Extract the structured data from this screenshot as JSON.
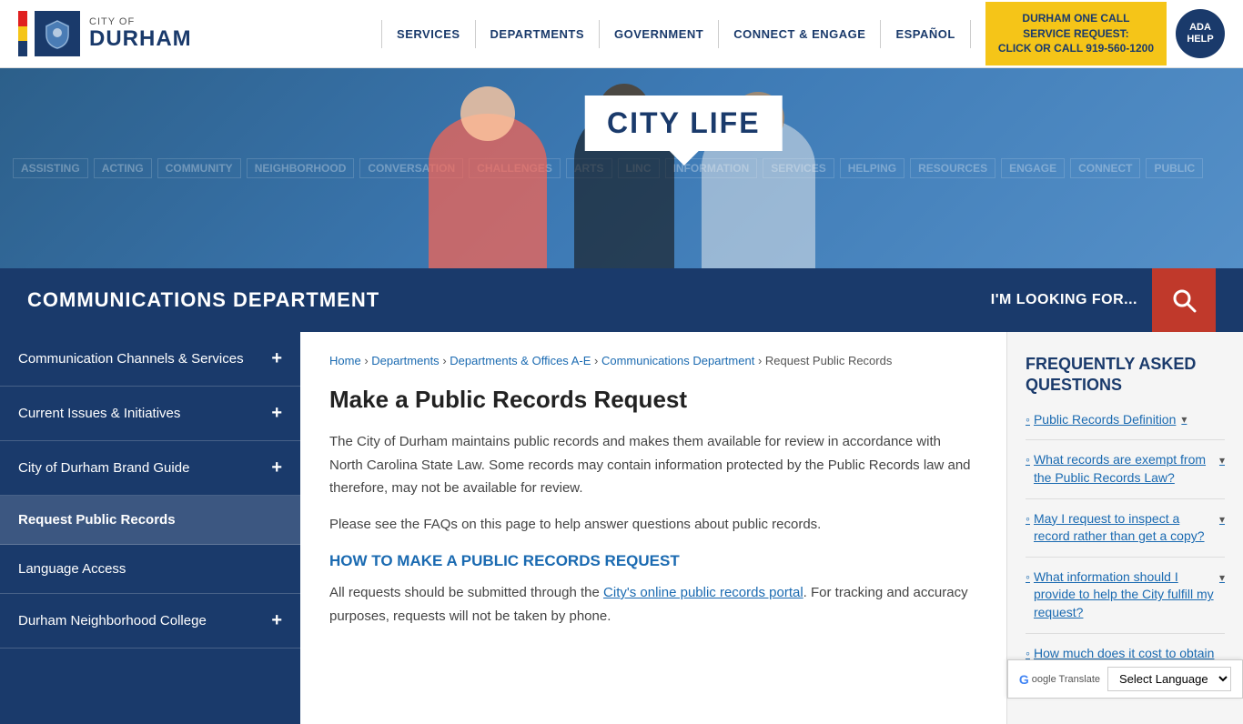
{
  "header": {
    "logo": {
      "city_label": "CITY OF",
      "durham_label": "DURHAM"
    },
    "nav": {
      "items": [
        {
          "label": "SERVICES",
          "href": "#"
        },
        {
          "label": "DEPARTMENTS",
          "href": "#"
        },
        {
          "label": "GOVERNMENT",
          "href": "#"
        },
        {
          "label": "CONNECT & ENGAGE",
          "href": "#"
        },
        {
          "label": "ESPAÑOL",
          "href": "#"
        }
      ]
    },
    "cta_button": {
      "line1": "DURHAM ONE CALL",
      "line2": "SERVICE REQUEST:",
      "line3": "CLICK OR CALL 919-560-1200"
    },
    "ada_button": "ADA HELP"
  },
  "hero": {
    "words": [
      "ASSISTING",
      "CITY LIFE",
      "ACTING",
      "NEIGHBORHOOD",
      "CONVERSATION",
      "CHALLENGES",
      "ARTS",
      "LINC",
      "INFORMATION",
      "SERVICES",
      "HELPING",
      "RESOURCES"
    ]
  },
  "dept_banner": {
    "title": "COMMUNICATIONS DEPARTMENT",
    "looking_for": "I'M LOOKING FOR..."
  },
  "breadcrumb": {
    "items": [
      "Home",
      "Departments",
      "Departments & Offices A-E",
      "Communications Department",
      "Request Public Records"
    ]
  },
  "page": {
    "title": "Make a Public Records Request",
    "body1": "The City of Durham maintains public records and makes them available for review in accordance with North Carolina State Law. Some records may contain information protected by the Public Records law and therefore, may not be available for review.",
    "body2": "Please see the FAQs on this page to help answer questions about public records.",
    "section_heading": "HOW TO MAKE A PUBLIC RECORDS REQUEST",
    "body3_before_link": "All requests should be submitted through the ",
    "body3_link": "City's online public records portal",
    "body3_after_link": ". For tracking and accuracy purposes, requests will not be taken by phone."
  },
  "sidebar": {
    "items": [
      {
        "label": "Communication Channels & Services",
        "expandable": true,
        "active": false
      },
      {
        "label": "Current Issues & Initiatives",
        "expandable": true,
        "active": false
      },
      {
        "label": "City of Durham Brand Guide",
        "expandable": true,
        "active": false
      },
      {
        "label": "Request Public Records",
        "expandable": false,
        "active": true
      },
      {
        "label": "Language Access",
        "expandable": false,
        "active": false
      },
      {
        "label": "Durham Neighborhood College",
        "expandable": true,
        "active": false
      }
    ]
  },
  "faq": {
    "title": "FREQUENTLY ASKED QUESTIONS",
    "items": [
      {
        "label": "Public Records Definition",
        "has_chevron": true
      },
      {
        "label": "What records are exempt from the Public Records Law?",
        "has_chevron": true
      },
      {
        "label": "May I request to inspect a record rather than get a copy?",
        "has_chevron": true
      },
      {
        "label": "What information should I provide to help the City fulfill my request?",
        "has_chevron": true
      },
      {
        "label": "How much does it cost to obtain a copy?",
        "has_chevron": false
      }
    ]
  },
  "language": {
    "label": "Select Language",
    "google_label": "Google Translate"
  }
}
